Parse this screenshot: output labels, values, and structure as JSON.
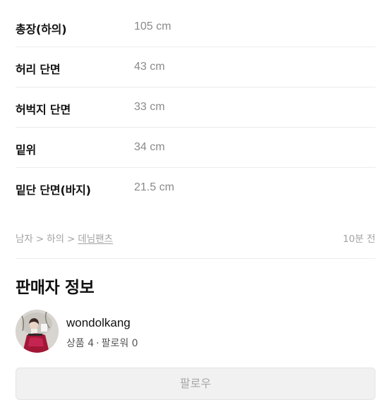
{
  "specs": [
    {
      "label": "총장(하의)",
      "value": "105 cm"
    },
    {
      "label": "허리 단면",
      "value": "43 cm"
    },
    {
      "label": "허벅지 단면",
      "value": "33 cm"
    },
    {
      "label": "밑위",
      "value": "34 cm"
    },
    {
      "label": "밑단 단면(바지)",
      "value": "21.5 cm"
    }
  ],
  "breadcrumb": {
    "items": [
      "남자",
      "하의",
      "데님팬츠"
    ],
    "separator": ">"
  },
  "posted_time": "10분 전",
  "seller": {
    "section_title": "판매자 정보",
    "name": "wondolkang",
    "products_label": "상품 4",
    "dot": "·",
    "followers_label": "팔로워 0",
    "avatar_icon": "seller-avatar-photo"
  },
  "follow_button_label": "팔로우",
  "colors": {
    "muted_text": "#a3a3a3",
    "value_text": "#8a8a8a",
    "divider": "#ececec",
    "button_bg": "#f1f1f1"
  }
}
